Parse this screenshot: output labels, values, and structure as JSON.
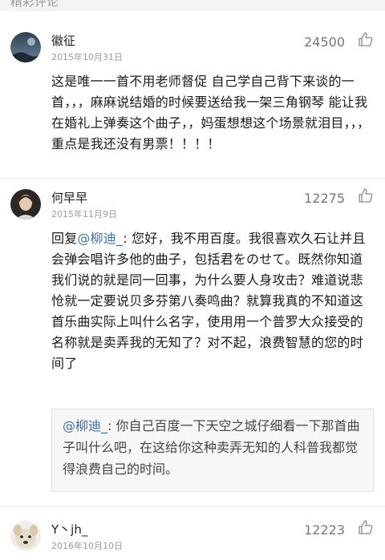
{
  "section_title": "精彩评论",
  "comments": [
    {
      "username": "徽征",
      "date": "2015年10月31日",
      "likes": "24500",
      "text": "这是唯一一首不用老师督促 自己学自己背下来谈的一首，，，麻麻说结婚的时候要送给我一架三角钢琴 能让我在婚礼上弹奏这个曲子，，妈蛋想想这个场景就泪目，，，重点是我还没有男票！！！！"
    },
    {
      "username": "何早早",
      "date": "2015年11月9日",
      "likes": "12275",
      "reply_prefix": "回复",
      "reply_mention": "@柳迪_",
      "text": ": 您好，我不用百度。我很喜欢久石让并且会弹会唱许多他的曲子，包括君をのせて。既然你知道我们说的就是同一回事，为什么要人身攻击？难道说悲怆就一定要说贝多芬第八奏鸣曲？就算我真的不知道这首乐曲实际上叫什么名字，使用用一个普罗大众接受的名称就是卖弄我的无知了？对不起，浪费智慧的您的时间了",
      "quote_mention": "@柳迪_",
      "quote_text": ": 你自己百度一下天空之城仔细看一下那首曲子叫什么吧，在这给你这种卖弄无知的人科普我都觉得浪费自己的时间。"
    },
    {
      "username": "Y丶jh_",
      "date": "2016年10月10日",
      "likes": "12223"
    }
  ],
  "icons": {
    "like": "thumbs-up-icon"
  },
  "colors": {
    "mention": "#3b6fa8",
    "muted": "#9a9a9a"
  }
}
